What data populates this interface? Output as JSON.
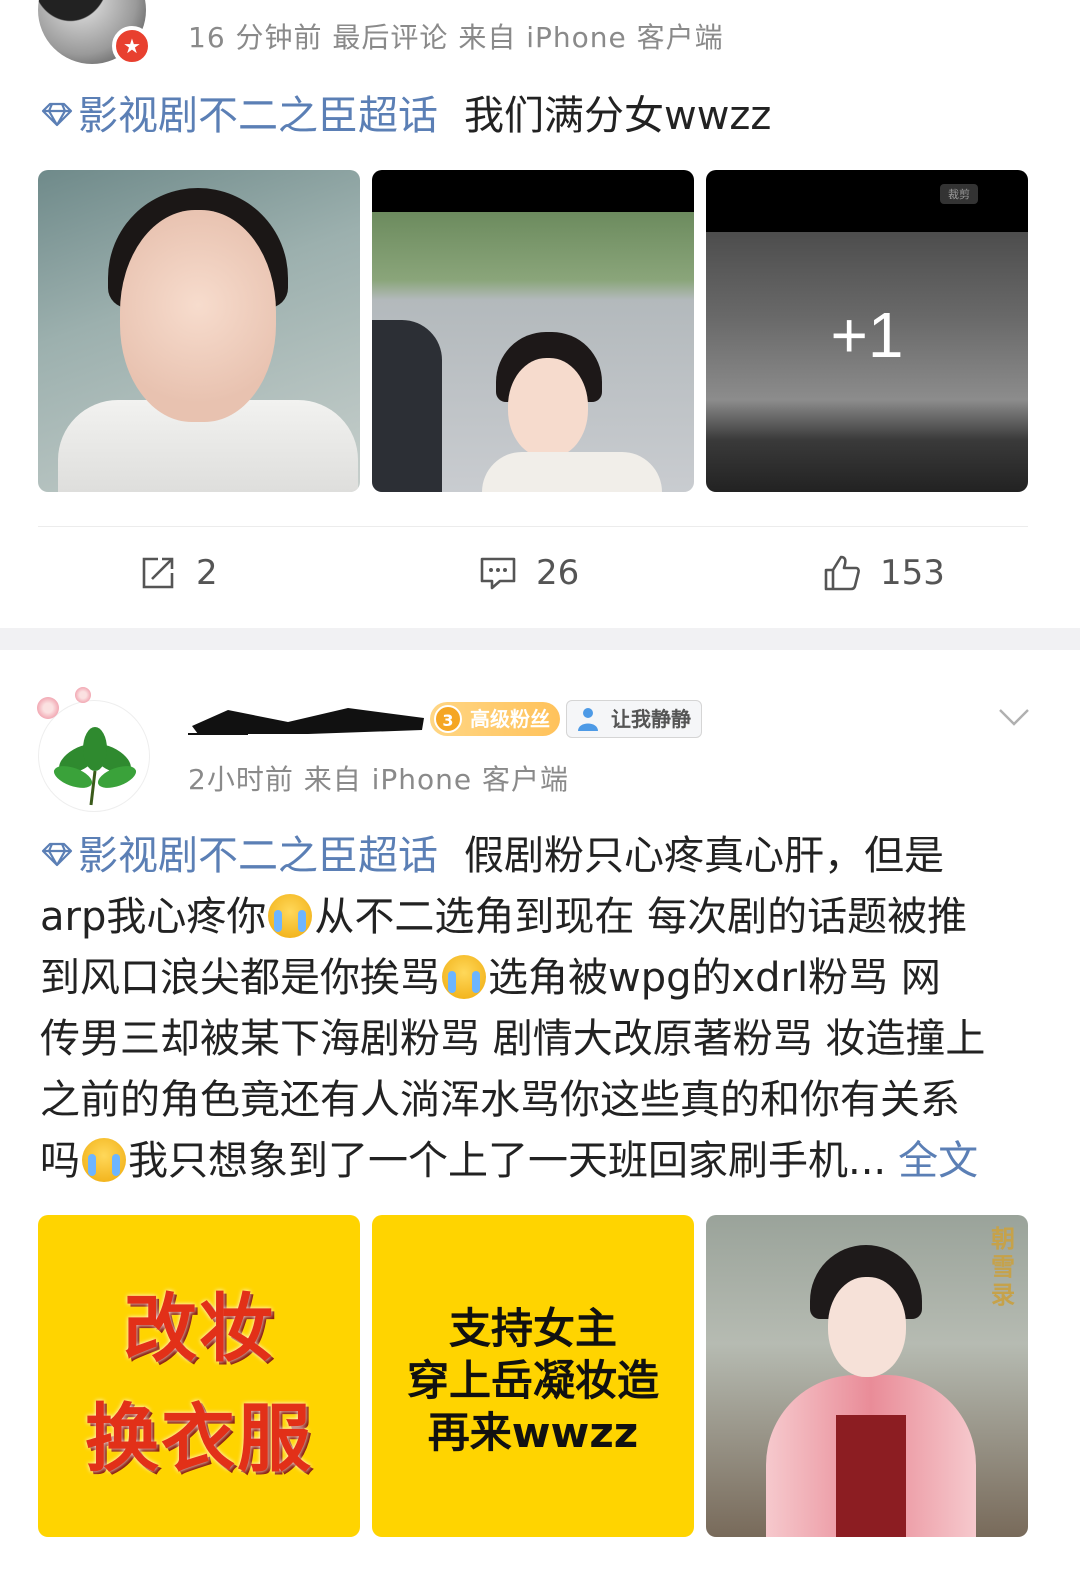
{
  "post1": {
    "meta": "16 分钟前  最后评论  来自 iPhone 客户端",
    "topic": "影视剧不二之臣超话",
    "text": "我们满分女wwzz",
    "more_images_label": "+1",
    "crop_label": "裁剪",
    "actions": {
      "repost_count": "2",
      "comment_count": "26",
      "like_count": "153"
    }
  },
  "post2": {
    "fan_level": "3",
    "fan_badge": "高级粉丝",
    "quiet_label": "让我静静",
    "meta": "2小时前  来自 iPhone 客户端",
    "topic": "影视剧不二之臣超话",
    "lines": [
      "假剧粉只心疼真心肝，但是",
      "arp我心疼你",
      "从不二选角到现在 每次剧的话题被推",
      "到风口浪尖都是你挨骂",
      "选角被wpg的xdrl粉骂  网",
      "传男三却被某下海剧粉骂 剧情大改原著粉骂 妆造撞上",
      "之前的角色竟还有人淌浑水骂你这些真的和你有关系",
      "吗",
      "我只想象到了一个上了一天班回家刷手机...",
      "全文"
    ],
    "images": {
      "img1_line1": "改妆",
      "img1_line2": "换衣服",
      "img2_line1": "支持女主",
      "img2_line2": "穿上岳凝妆造",
      "img2_line3": "再来wwzz",
      "img3_calligraphy": "朝雪录"
    }
  },
  "colors": {
    "topic_blue": "#5b7fb5",
    "meta_gray": "#8a8a8a",
    "separator": "#f1f1f3",
    "badge_gold": "#ffc25b",
    "poster_yellow": "#ffd400"
  },
  "icons": [
    "diamond-icon",
    "repost-icon",
    "comment-icon",
    "like-icon",
    "chevron-down-icon",
    "person-icon",
    "verified-badge-icon",
    "crying-emoji-icon"
  ]
}
